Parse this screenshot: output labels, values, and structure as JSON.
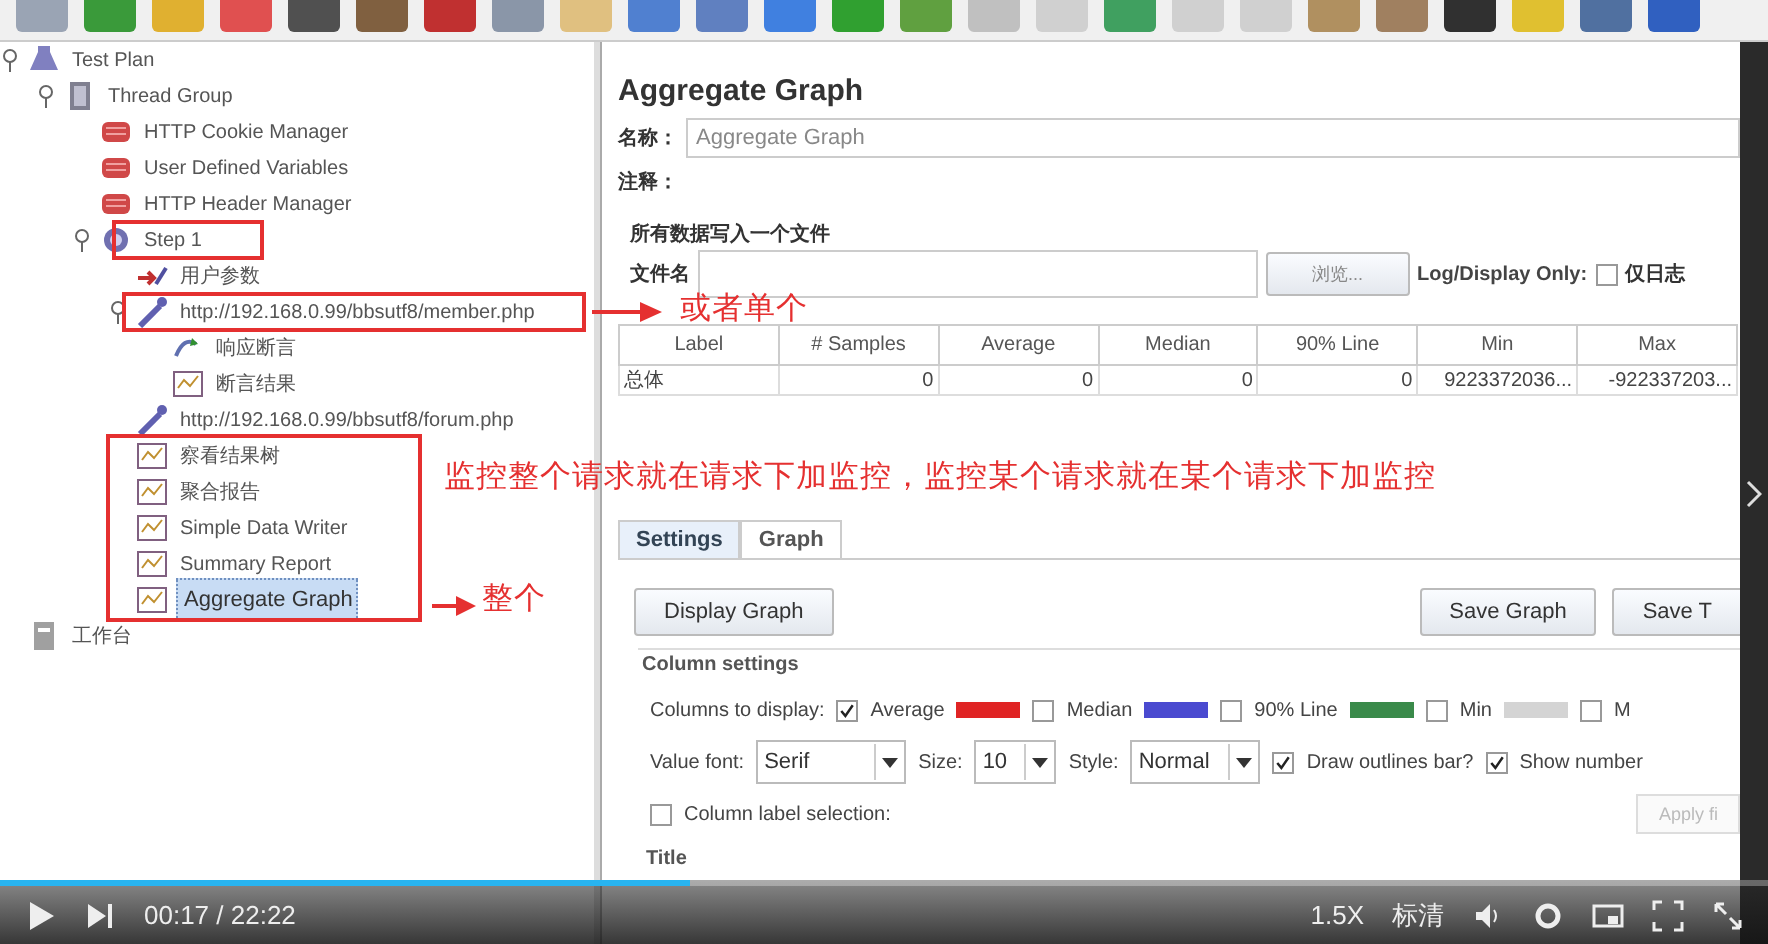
{
  "tree": [
    {
      "label": "Test Plan",
      "kind": "plan",
      "expanded": true,
      "selected": false,
      "children": [
        {
          "label": "Thread Group",
          "kind": "thread",
          "expanded": true,
          "selected": false,
          "children": [
            {
              "label": "HTTP Cookie Manager",
              "kind": "config",
              "selected": false
            },
            {
              "label": "User Defined Variables",
              "kind": "config",
              "selected": false
            },
            {
              "label": "HTTP Header Manager",
              "kind": "config",
              "selected": false
            },
            {
              "label": "Step 1",
              "kind": "controller",
              "expanded": true,
              "selected": false,
              "children": [
                {
                  "label": "用户参数",
                  "kind": "preprocessor",
                  "selected": false
                },
                {
                  "label": "http://192.168.0.99/bbsutf8/member.php",
                  "kind": "sampler",
                  "expanded": true,
                  "selected": false,
                  "children": [
                    {
                      "label": "响应断言",
                      "kind": "assertion",
                      "selected": false
                    },
                    {
                      "label": "断言结果",
                      "kind": "listener",
                      "selected": false
                    }
                  ]
                },
                {
                  "label": "http://192.168.0.99/bbsutf8/forum.php",
                  "kind": "sampler",
                  "selected": false
                },
                {
                  "label": "察看结果树",
                  "kind": "listener",
                  "selected": false
                },
                {
                  "label": "聚合报告",
                  "kind": "listener",
                  "selected": false
                },
                {
                  "label": "Simple Data Writer",
                  "kind": "listener",
                  "selected": false
                },
                {
                  "label": "Summary Report",
                  "kind": "listener",
                  "selected": false
                },
                {
                  "label": "Aggregate Graph",
                  "kind": "listener",
                  "selected": true
                }
              ]
            }
          ]
        }
      ]
    },
    {
      "label": "工作台",
      "kind": "workbench",
      "selected": false
    }
  ],
  "panel": {
    "title": "Aggregate Graph",
    "name_label": "名称：",
    "name_value": "Aggregate Graph",
    "comment_label": "注释：",
    "file_group": "所有数据写入一个文件",
    "file_label": "文件名",
    "browse": "浏览...",
    "log_display_label": "Log/Display Only:",
    "errors_only": {
      "label": "仅日志",
      "checked": false
    },
    "table": {
      "columns": [
        "Label",
        "# Samples",
        "Average",
        "Median",
        "90% Line",
        "Min",
        "Max"
      ],
      "rows": [
        [
          "总体",
          "0",
          "0",
          "0",
          "0",
          "9223372036...",
          "-922337203..."
        ]
      ]
    },
    "tabs": [
      {
        "label": "Settings",
        "selected": true
      },
      {
        "label": "Graph",
        "selected": false
      }
    ],
    "buttons": {
      "display": "Display Graph",
      "save_graph": "Save Graph",
      "save_table": "Save T"
    },
    "column_settings": {
      "title": "Column settings",
      "columns_label": "Columns to display:",
      "columns": [
        {
          "label": "Average",
          "checked": true,
          "color": "#e02424"
        },
        {
          "label": "Median",
          "checked": false,
          "color": "#4a4ad0"
        },
        {
          "label": "90% Line",
          "checked": false,
          "color": "#3a8a4a"
        },
        {
          "label": "Min",
          "checked": false,
          "color": "#d4d4d4"
        },
        {
          "label": "M",
          "checked": false
        }
      ],
      "font_label": "Value font:",
      "font_value": "Serif",
      "size_label": "Size:",
      "size_value": "10",
      "style_label": "Style:",
      "style_value": "Normal",
      "outlines": {
        "label": "Draw outlines bar?",
        "checked": true
      },
      "show_number": {
        "label": "Show number",
        "checked": true
      },
      "label_selection": {
        "label": "Column label selection:",
        "checked": false
      },
      "apply": "Apply fi"
    },
    "next_title": "Title"
  },
  "annotations": [
    {
      "text": "或者单个"
    },
    {
      "text": "监控整个请求就在请求下加监控，监控某个请求就在某个请求下加监控"
    },
    {
      "text": "整个"
    }
  ],
  "player": {
    "level": 0.39,
    "time": "00:17 / 22:22",
    "speed": "1.5X",
    "quality": "标清"
  }
}
